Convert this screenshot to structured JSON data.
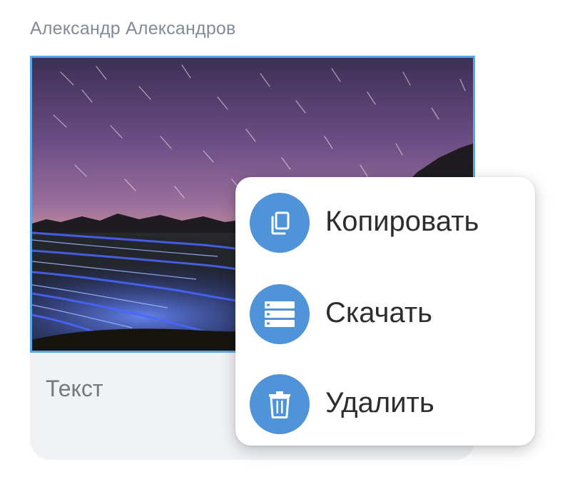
{
  "message": {
    "sender_name": "Александр Александров",
    "caption": "Текст"
  },
  "context_menu": {
    "items": [
      {
        "id": "copy",
        "label": "Копировать",
        "icon": "copy-icon"
      },
      {
        "id": "download",
        "label": "Скачать",
        "icon": "download-list-icon"
      },
      {
        "id": "delete",
        "label": "Удалить",
        "icon": "trash-icon"
      }
    ]
  },
  "colors": {
    "accent": "#4f94d8",
    "selection_border": "#5aa7e8",
    "bubble_background": "#f0f2f5",
    "sender_text": "#818c99",
    "menu_text": "#2c2d2e"
  }
}
